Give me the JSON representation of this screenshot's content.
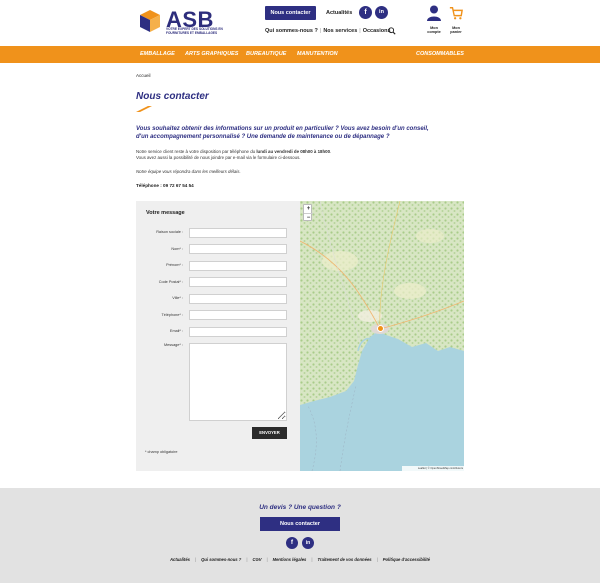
{
  "brand": {
    "name": "ASB",
    "tagline": "Votre expert des solutions en fournitures et emballages",
    "accent": "#2e2f82",
    "orange": "#f0921b"
  },
  "header": {
    "contact_button": "Nous contacter",
    "news_link": "Actualités",
    "social": {
      "facebook": "f",
      "linkedin": "in"
    },
    "links": [
      "Qui sommes-nous ?",
      "Nos services",
      "Occasions"
    ],
    "account_label": "Mon compte",
    "cart_label": "Mon panier"
  },
  "nav": [
    "Emballage",
    "Arts graphiques",
    "Bureautique",
    "Manutention",
    "Consommables"
  ],
  "breadcrumb": "Accueil",
  "page": {
    "title": "Nous contacter",
    "intro": "Vous souhaitez obtenir des informations sur un produit en particulier ? Vous avez besoin d'un conseil, d'un accompagnement personnalisé ? Une demande de maintenance ou de dépannage ?",
    "availability_pre": "Notre service client reste à votre disposition par téléphone du ",
    "availability_hours": "lundi au vendredi de 08h00 à 18h00",
    "availability_post": ".",
    "form_note": "Vous avez aussi la possibilité de nous joindre par e-mail via le formulaire ci-dessous.",
    "reply_note": "Notre équipe vous répondra dans les meilleurs délais.",
    "phone": "Téléphone : 09 72 67 54 54"
  },
  "form": {
    "title": "Votre message",
    "fields": [
      {
        "label": "Raison sociale :",
        "value": ""
      },
      {
        "label": "Nom* :",
        "value": ""
      },
      {
        "label": "Prénom* :",
        "value": ""
      },
      {
        "label": "Code Postal* :",
        "value": ""
      },
      {
        "label": "Ville* :",
        "value": ""
      },
      {
        "label": "Téléphone* :",
        "value": ""
      },
      {
        "label": "Email* :",
        "value": ""
      }
    ],
    "message_label": "Message* :",
    "submit": "ENVOYER",
    "required_note": "* champ obligatoire"
  },
  "map": {
    "zoom_in": "+",
    "zoom_out": "−",
    "attribution": "Leaflet | © OpenStreetMap contributors"
  },
  "footer": {
    "question": "Un devis ? Une question ?",
    "contact_button": "Nous contacter",
    "social": {
      "facebook": "f",
      "linkedin": "in"
    },
    "links": [
      "Actualités",
      "Qui sommes-nous ?",
      "CGV",
      "Mentions légales",
      "Traitement de vos données",
      "Politique d'accessibilité"
    ]
  }
}
